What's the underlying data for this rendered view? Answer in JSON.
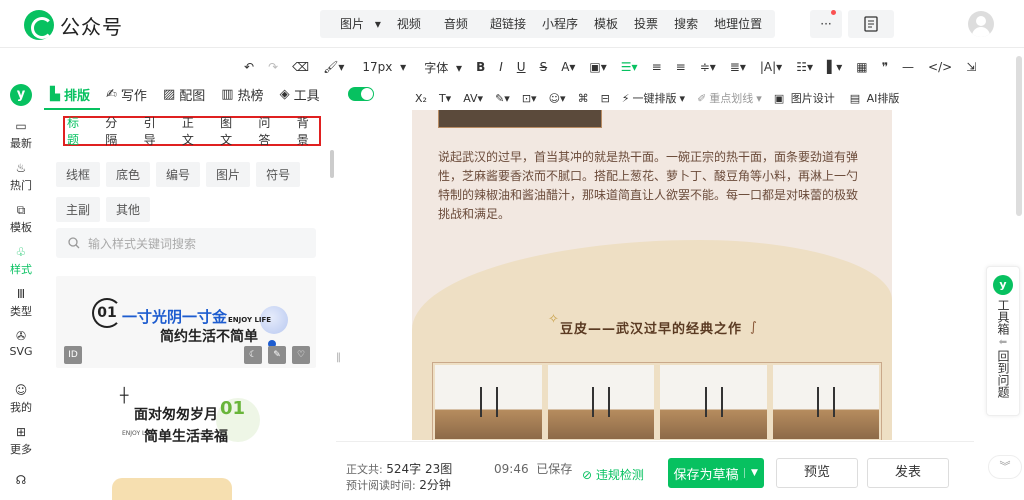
{
  "app": {
    "title": "公众号",
    "brand_color": "#07c160"
  },
  "topbar": {
    "media_group": [
      {
        "label": "图片",
        "dropdown": true
      },
      {
        "label": "视频",
        "dropdown": false
      },
      {
        "label": "音频",
        "dropdown": true
      }
    ],
    "insert_group": [
      "超链接",
      "小程序",
      "模板",
      "投票",
      "搜索",
      "地理位置"
    ],
    "more_label": "···"
  },
  "format_toolbar": {
    "font_size": "17px",
    "font_family": "字体",
    "row2_labels": {
      "one_click": "一键排版",
      "highlight": "重点划线",
      "image_design": "图片设计",
      "ai_layout": "AI排版"
    }
  },
  "sidenav": {
    "items": [
      {
        "label": "最新",
        "icon": "chat-icon"
      },
      {
        "label": "热门",
        "icon": "fire-icon"
      },
      {
        "label": "模板",
        "icon": "template-icon"
      },
      {
        "label": "样式",
        "icon": "style-icon",
        "active": true
      },
      {
        "label": "类型",
        "icon": "type-icon"
      },
      {
        "label": "SVG",
        "icon": "svg-icon"
      },
      {
        "label": "我的",
        "icon": "user-icon"
      },
      {
        "label": "更多",
        "icon": "grid-icon"
      }
    ]
  },
  "panel": {
    "tabs": [
      {
        "label": "排版",
        "active": true
      },
      {
        "label": "写作"
      },
      {
        "label": "配图"
      },
      {
        "label": "热榜"
      },
      {
        "label": "工具"
      }
    ],
    "categories": [
      "标题",
      "分隔",
      "引导",
      "正文",
      "图文",
      "问答",
      "背景"
    ],
    "chips": [
      "线框",
      "底色",
      "编号",
      "图片",
      "符号",
      "主副",
      "其他"
    ],
    "search_placeholder": "输入样式关键词搜索",
    "card1": {
      "num": "01",
      "line1": "一寸光阴一寸金",
      "line2": "简约生活不简单",
      "en": "ENJOY LIFE",
      "id": "ID"
    },
    "card2": {
      "line1": "面对匆匆岁月",
      "line2": "简单生活幸福",
      "num": "01",
      "en": "ENJOY LIFE"
    }
  },
  "editor": {
    "paragraph": "说起武汉的过早，首当其冲的就是热干面。一碗正宗的热干面，面条要劲道有弹性，芝麻酱要香浓而不腻口。搭配上葱花、萝卜丁、酸豆角等小料，再淋上一勺特制的辣椒油和酱油醋汁，那味道简直让人欲罢不能。每一口都是对味蕾的极致挑战和满足。",
    "subtitle": "豆皮——武汉过早的经典之作"
  },
  "toolbox": {
    "label": "工具箱",
    "back_label": "回到问题"
  },
  "bottom": {
    "word_count_label": "正文共:",
    "word_count": "524字 23图",
    "read_time_label": "预计阅读时间:",
    "read_time": "2分钟",
    "saved_time": "09:46",
    "saved_label": "已保存",
    "violation_check": "违规检测",
    "save_draft": "保存为草稿",
    "preview": "预览",
    "publish": "发表"
  }
}
